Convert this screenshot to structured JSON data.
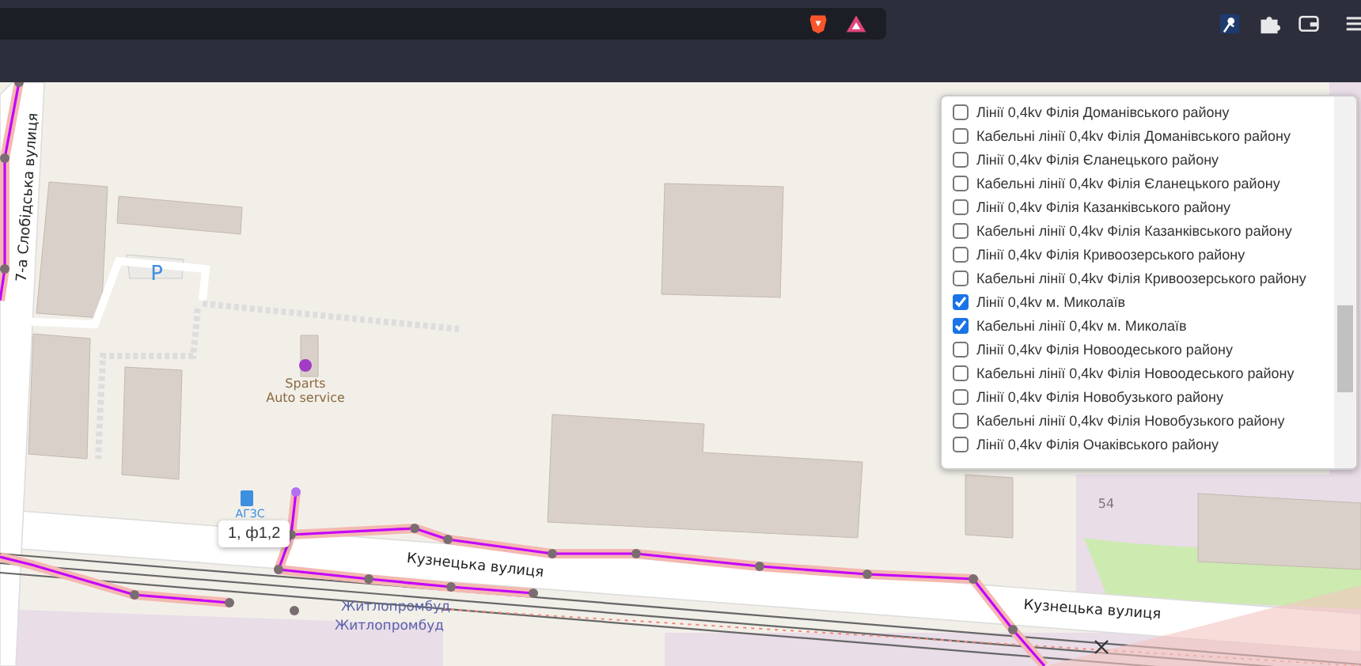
{
  "map": {
    "street_labels": [
      "7-а Слобідська вулиця",
      "Кузнецька вулиця",
      "Кузнецька вулиця"
    ],
    "poi_labels": [
      "P",
      "Sparts",
      "Auto service",
      "АГЗС",
      "Житлопромбуд",
      "Житлопромбуд",
      "54"
    ],
    "tooltip": "1, ф1,2"
  },
  "layers": [
    {
      "label": "Лінії 0,4kv Філія Доманівського району",
      "checked": false
    },
    {
      "label": "Кабельні лінії 0,4kv Філія Доманівського району",
      "checked": false
    },
    {
      "label": "Лінії 0,4kv Філія Єланецького району",
      "checked": false
    },
    {
      "label": "Кабельні лінії 0,4kv Філія Єланецького району",
      "checked": false
    },
    {
      "label": "Лінії 0,4kv Філія Казанківського району",
      "checked": false
    },
    {
      "label": "Кабельні лінії 0,4kv Філія Казанківського району",
      "checked": false
    },
    {
      "label": "Лінії 0,4kv Філія Кривоозерського району",
      "checked": false
    },
    {
      "label": "Кабельні лінії 0,4kv Філія Кривоозерського району",
      "checked": false
    },
    {
      "label": "Лінії 0,4kv м. Миколаїв",
      "checked": true
    },
    {
      "label": "Кабельні лінії 0,4kv м. Миколаїв",
      "checked": true
    },
    {
      "label": "Лінії 0,4kv Філія Новоодеського району",
      "checked": false
    },
    {
      "label": "Кабельні лінії 0,4kv Філія Новоодеського району",
      "checked": false
    },
    {
      "label": "Лінії 0,4kv Філія Новобузького району",
      "checked": false
    },
    {
      "label": "Кабельні лінії 0,4kv Філія Новобузького району",
      "checked": false
    },
    {
      "label": "Лінії 0,4kv Філія Очаківського району",
      "checked": false
    }
  ]
}
